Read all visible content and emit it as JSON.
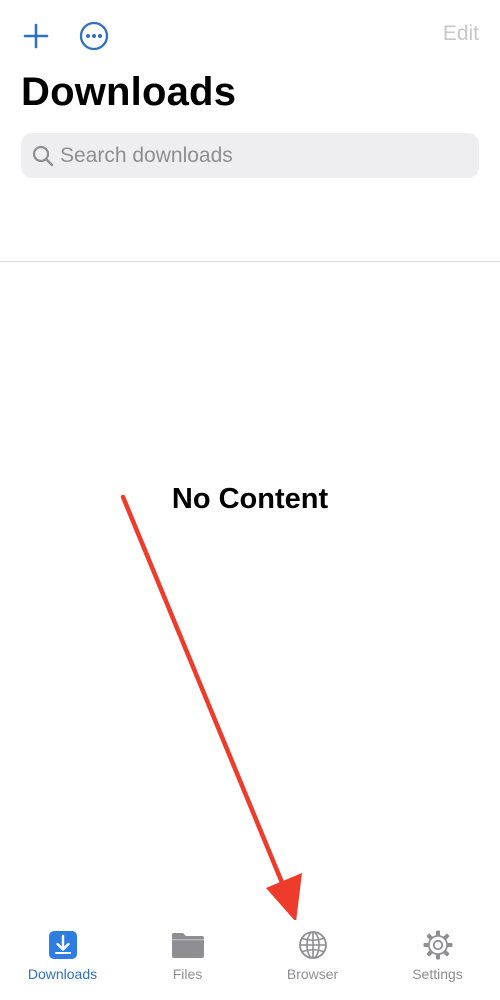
{
  "toolbar": {
    "add_icon": "plus-icon",
    "more_icon": "ellipsis-circle-icon",
    "edit_label": "Edit"
  },
  "header": {
    "title": "Downloads"
  },
  "search": {
    "placeholder": "Search downloads",
    "value": ""
  },
  "main": {
    "empty_message": "No Content"
  },
  "tabbar": {
    "active_tab": "Downloads",
    "items": [
      {
        "label": "Downloads",
        "icon": "download-tray-icon"
      },
      {
        "label": "Files",
        "icon": "folder-icon"
      },
      {
        "label": "Browser",
        "icon": "globe-icon"
      },
      {
        "label": "Settings",
        "icon": "gear-icon"
      }
    ]
  },
  "colors": {
    "accent": "#2f6fc4",
    "inactive": "#8e8e93",
    "disabled": "#c7c7cc",
    "annotation_arrow": "#ee3b2b",
    "search_bg": "#eeeef0"
  }
}
